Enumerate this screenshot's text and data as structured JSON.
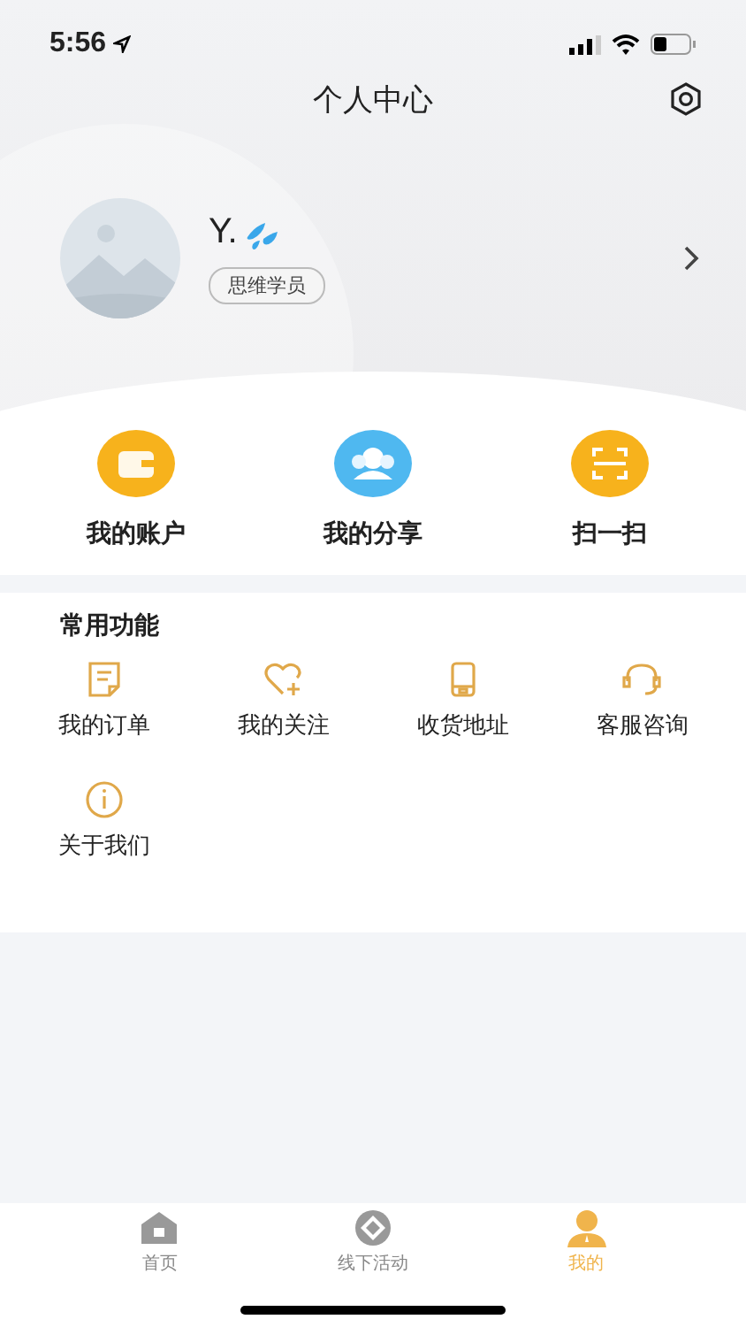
{
  "status_bar": {
    "time": "5:56"
  },
  "nav": {
    "title": "个人中心"
  },
  "profile": {
    "name": "Y.",
    "badge": "思维学员"
  },
  "quick_actions": [
    {
      "kind": "wallet",
      "label": "我的账户",
      "color": "#f7b21c"
    },
    {
      "kind": "share",
      "label": "我的分享",
      "color": "#4fb8f0"
    },
    {
      "kind": "scan",
      "label": "扫一扫",
      "color": "#f7b21c"
    }
  ],
  "functions": {
    "title": "常用功能",
    "items": [
      {
        "kind": "order",
        "label": "我的订单"
      },
      {
        "kind": "follow",
        "label": "我的关注"
      },
      {
        "kind": "address",
        "label": "收货地址"
      },
      {
        "kind": "service",
        "label": "客服咨询"
      },
      {
        "kind": "about",
        "label": "关于我们"
      }
    ]
  },
  "tab_bar": [
    {
      "kind": "home",
      "label": "首页",
      "selected": false
    },
    {
      "kind": "activity",
      "label": "线下活动",
      "selected": false
    },
    {
      "kind": "me",
      "label": "我的",
      "selected": true
    }
  ]
}
